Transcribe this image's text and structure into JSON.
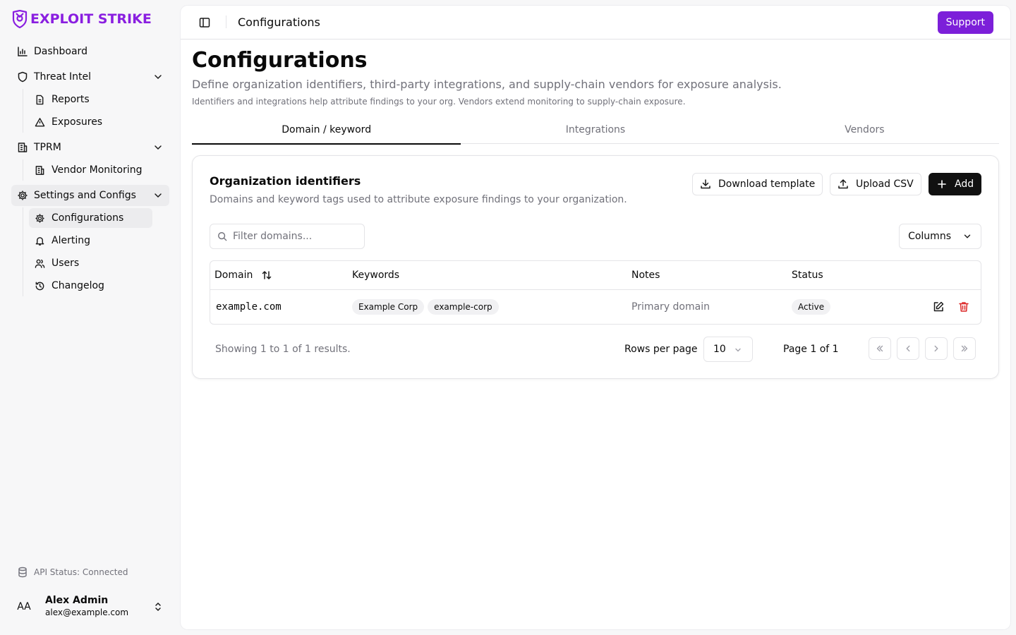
{
  "brand": {
    "name": "EXPLOIT STRIKE",
    "color": "#8a1fe0",
    "icon": "shield-logo-icon"
  },
  "sidebar": {
    "nav": [
      {
        "label": "Dashboard",
        "icon": "bar-chart-icon"
      },
      {
        "label": "Threat Intel",
        "icon": "shield-icon",
        "expanded": true,
        "children": [
          {
            "label": "Reports",
            "icon": "file-text-icon"
          },
          {
            "label": "Exposures",
            "icon": "alert-triangle-icon"
          }
        ]
      },
      {
        "label": "TPRM",
        "icon": "building-icon",
        "expanded": true,
        "children": [
          {
            "label": "Vendor Monitoring",
            "icon": "building-icon"
          }
        ]
      },
      {
        "label": "Settings and Configs",
        "icon": "gear-icon",
        "expanded": true,
        "children": [
          {
            "label": "Configurations",
            "icon": "gear-icon",
            "active": true
          },
          {
            "label": "Alerting",
            "icon": "bell-icon"
          },
          {
            "label": "Users",
            "icon": "users-icon"
          },
          {
            "label": "Changelog",
            "icon": "history-icon"
          }
        ]
      }
    ],
    "api_status": "API Status: Connected",
    "user": {
      "initials": "AA",
      "name": "Alex Admin",
      "email": "alex@example.com"
    }
  },
  "topbar": {
    "title": "Configurations",
    "support_label": "Support",
    "support_color": "#7c1fd9"
  },
  "page": {
    "title": "Configurations",
    "description": "Define organization identifiers, third-party integrations, and supply-chain vendors for exposure analysis.",
    "note": "Identifiers and integrations help attribute findings to your org. Vendors extend monitoring to supply-chain exposure."
  },
  "tabs": [
    {
      "label": "Domain / keyword",
      "active": true
    },
    {
      "label": "Integrations",
      "active": false
    },
    {
      "label": "Vendors",
      "active": false
    }
  ],
  "card": {
    "title": "Organization identifiers",
    "description": "Domains and keyword tags used to attribute exposure findings to your organization.",
    "buttons": {
      "download": "Download template",
      "upload": "Upload CSV",
      "add": "Add"
    },
    "filter_placeholder": "Filter domains...",
    "columns_label": "Columns",
    "table": {
      "headers": {
        "domain": "Domain",
        "keywords": "Keywords",
        "notes": "Notes",
        "status": "Status"
      },
      "rows": [
        {
          "domain": "example.com",
          "keywords": [
            "Example Corp",
            "example-corp"
          ],
          "notes": "Primary domain",
          "status": "Active"
        }
      ]
    },
    "pagination": {
      "showing": "Showing 1 to 1 of 1 results.",
      "rows_per_page_label": "Rows per page",
      "rows_per_page": "10",
      "page_label": "Page 1 of 1"
    }
  },
  "colors": {
    "delete": "#dc2626"
  }
}
